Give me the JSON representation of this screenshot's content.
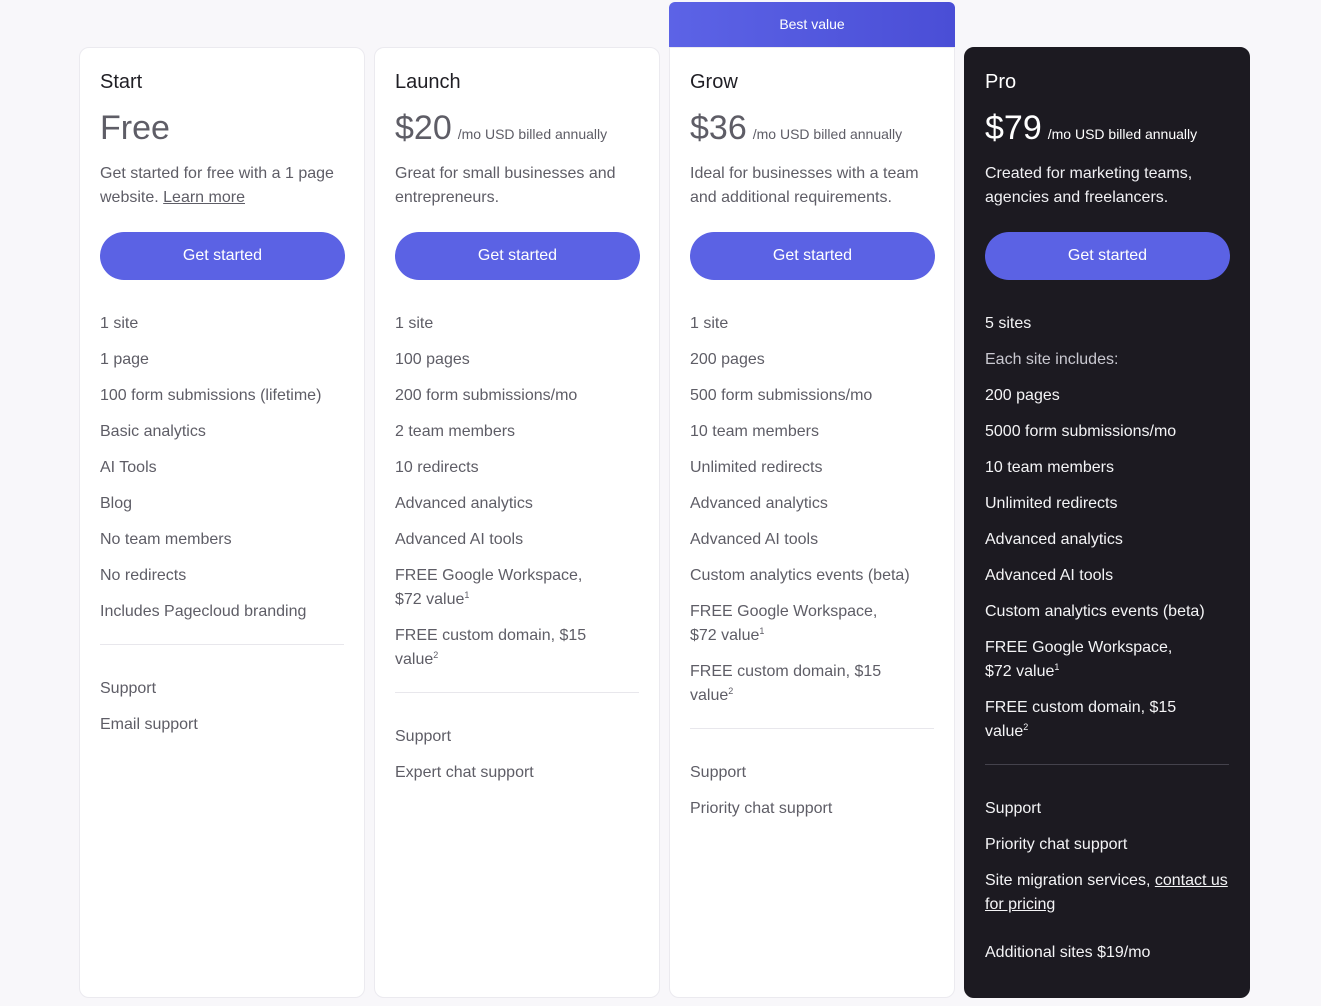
{
  "badge": "Best value",
  "plans": [
    {
      "name": "Start",
      "price": "Free",
      "period": "",
      "description": "Get started for free with a 1 page website.",
      "description_link": "Learn more",
      "cta": "Get started",
      "features": [
        "1 site",
        "1 page",
        "100 form submissions (lifetime)",
        "Basic analytics",
        "AI Tools",
        "Blog",
        "No team members",
        "No redirects",
        "Includes Pagecloud branding"
      ],
      "support": [
        "Support",
        "Email support"
      ]
    },
    {
      "name": "Launch",
      "price": "$20",
      "period": "/mo USD billed annually",
      "description": "Great for small businesses and entrepreneurs.",
      "cta": "Get started",
      "features": [
        "1 site",
        "100 pages",
        "200 form submissions/mo",
        "2 team members",
        "10 redirects",
        "Advanced analytics",
        "Advanced AI tools"
      ],
      "workspace": "FREE Google Workspace, $72 value",
      "domain": "FREE custom domain, $15 value",
      "support": [
        "Support",
        "Expert chat support"
      ]
    },
    {
      "name": "Grow",
      "price": "$36",
      "period": "/mo USD billed annually",
      "description": "Ideal for businesses with a team and additional requirements.",
      "cta": "Get started",
      "features": [
        "1 site",
        "200 pages",
        "500 form submissions/mo",
        "10 team members",
        "Unlimited redirects",
        "Advanced analytics",
        "Advanced AI tools",
        "Custom analytics events (beta)"
      ],
      "workspace": "FREE Google Workspace, $72 value",
      "domain": "FREE custom domain, $15 value",
      "support": [
        "Support",
        "Priority chat support"
      ]
    },
    {
      "name": "Pro",
      "price": "$79",
      "period": "/mo USD billed annually",
      "description": "Created for marketing teams, agencies and freelancers.",
      "cta": "Get started",
      "features": [
        "5 sites",
        "Each site includes:",
        "200 pages",
        "5000 form submissions/mo",
        "10 team members",
        "Unlimited redirects",
        "Advanced analytics",
        "Advanced AI tools",
        "Custom analytics events (beta)"
      ],
      "workspace": "FREE Google Workspace, $72 value",
      "domain": "FREE custom domain, $15 value",
      "support": [
        "Support",
        "Priority chat support"
      ],
      "migration_text": "Site migration services,",
      "migration_link": "contact us for pricing",
      "additional": "Additional sites $19/mo"
    }
  ],
  "footnote_1": "1",
  "footnote_2": "2",
  "colors": {
    "accent": "#5b62e4",
    "pro_bg": "#1c1a21",
    "page_bg": "#f8f7fa"
  }
}
